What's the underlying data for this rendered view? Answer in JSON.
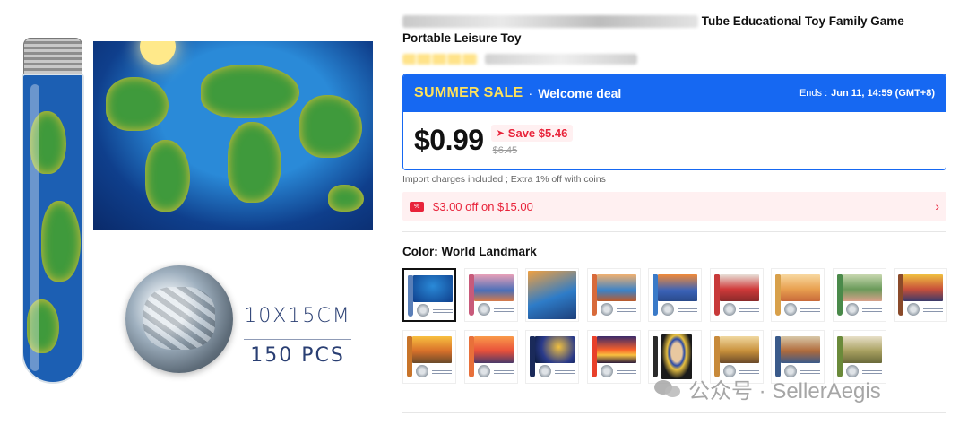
{
  "product": {
    "title_visible": "Tube Educational Toy Family Game",
    "title_line2": "Portable Leisure Toy"
  },
  "promo": {
    "sale_name": "SUMMER SALE",
    "separator": "·",
    "deal_label": "Welcome deal",
    "ends_label": "Ends :",
    "ends_value": "Jun 11, 14:59 (GMT+8)",
    "price": "$0.99",
    "save_text": "Save $5.46",
    "original_price": "$6.45",
    "brand_color": "#1668f2",
    "accent_color": "#e8233a",
    "sale_text_color": "#ffe25a"
  },
  "import_note": "Import charges included ; Extra 1% off with coins",
  "coupon": {
    "text": "$3.00 off on $15.00",
    "icon": "coupon-ticket-icon",
    "arrow": "›"
  },
  "color": {
    "label": "Color: World Landmark",
    "selected_index": 0,
    "swatch_count": 17
  },
  "gallery": {
    "size_text": "10X15CM",
    "pieces_text": "150 PCS"
  },
  "watermark": {
    "text": "公众号 · SellerAegis"
  }
}
